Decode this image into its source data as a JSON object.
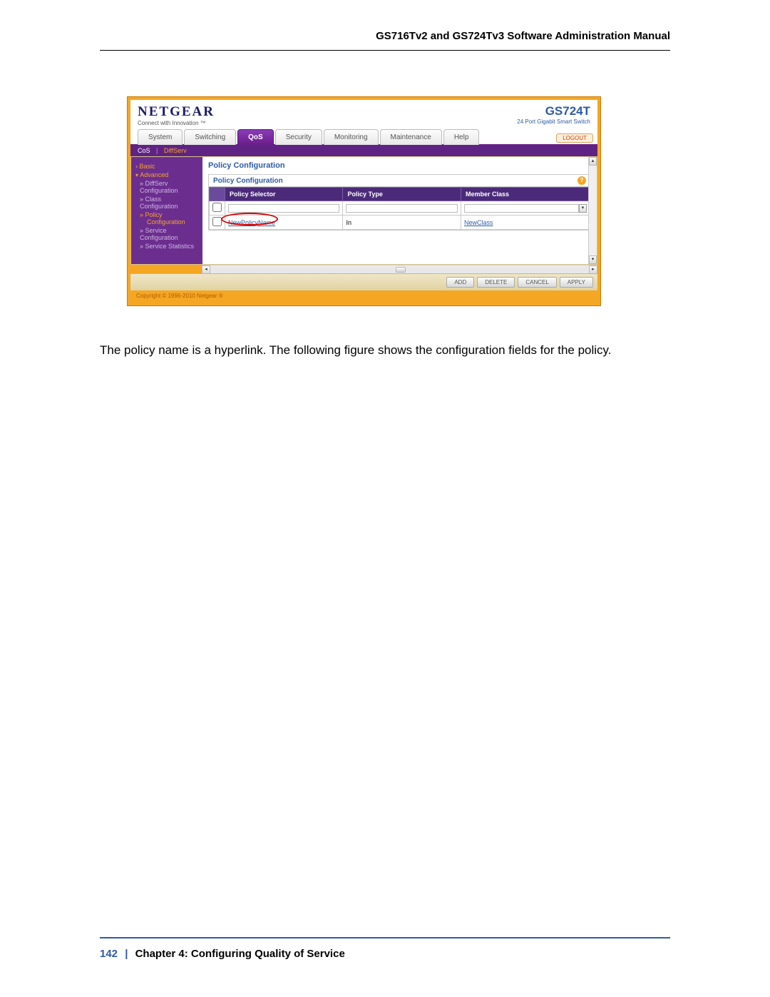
{
  "doc": {
    "header_title": "GS716Tv2 and GS724Tv3 Software Administration Manual",
    "body_paragraph": "The policy name is a hyperlink. The following figure shows the configuration fields for the policy.",
    "page_number": "142",
    "footer_separator": "|",
    "chapter_label": "Chapter 4:  Configuring Quality of Service"
  },
  "ui": {
    "brand": {
      "logo": "NETGEAR",
      "tagline": "Connect with Innovation ™",
      "model": "GS724T",
      "model_desc": "24 Port Gigabit Smart Switch"
    },
    "tabs": [
      "System",
      "Switching",
      "QoS",
      "Security",
      "Monitoring",
      "Maintenance",
      "Help"
    ],
    "active_tab_index": 2,
    "logout": "LOGOUT",
    "subnav": {
      "item0": "CoS",
      "sep": "|",
      "item1": "DiffServ"
    },
    "sidebar": {
      "basic": "Basic",
      "advanced": "Advanced",
      "diffserv_cfg": "DiffServ Configuration",
      "class_cfg": "Class Configuration",
      "policy_cfg_label": "Policy",
      "policy_cfg_sub": "Configuration",
      "service_cfg": "Service Configuration",
      "service_stats": "Service Statistics"
    },
    "panel": {
      "title": "Policy Configuration",
      "inner_title": "Policy Configuration",
      "help_glyph": "?",
      "columns": {
        "selector": "Policy Selector",
        "type": "Policy Type",
        "member": "Member Class"
      },
      "rows": [
        {
          "selector": "NewPolicyName",
          "type": "In",
          "member": "NewClass"
        }
      ]
    },
    "footer_buttons": [
      "ADD",
      "DELETE",
      "CANCEL",
      "APPLY"
    ],
    "copyright": "Copyright © 1996-2010 Netgear ®"
  }
}
